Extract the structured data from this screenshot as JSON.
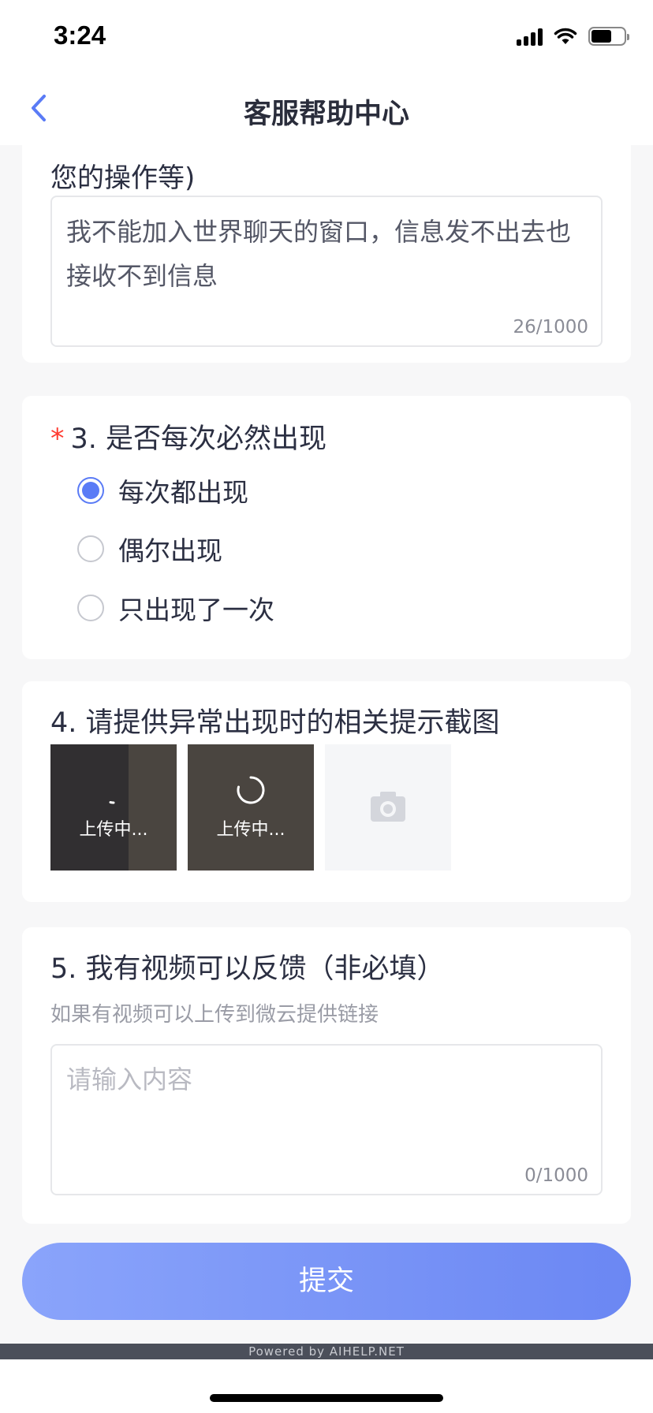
{
  "status_bar": {
    "time": "3:24"
  },
  "nav": {
    "title": "客服帮助中心",
    "back_icon": "chevron-left-icon"
  },
  "question2": {
    "title_continued": "您的操作等)",
    "value": "我不能加入世界聊天的窗口，信息发不出去也接收不到信息",
    "counter": "26/1000"
  },
  "question3": {
    "required_mark": "*",
    "title": "3. 是否每次必然出现",
    "options": [
      {
        "label": "每次都出现",
        "selected": true
      },
      {
        "label": "偶尔出现",
        "selected": false
      },
      {
        "label": "只出现了一次",
        "selected": false
      }
    ]
  },
  "question4": {
    "title": "4. 请提供异常出现时的相关提示截图",
    "uploads": [
      {
        "status": "上传中..."
      },
      {
        "status": "上传中..."
      }
    ],
    "add_icon": "camera-icon"
  },
  "question5": {
    "title": "5. 我有视频可以反馈（非必填）",
    "hint": "如果有视频可以上传到微云提供链接",
    "placeholder": "请输入内容",
    "counter": "0/1000"
  },
  "submit_label": "提交",
  "footer": {
    "powered": "Powered by AIHELP.NET"
  },
  "colors": {
    "accent": "#5a7bf6",
    "required": "#ff3b30",
    "button_start": "#8aa4fb",
    "button_end": "#6b87f3"
  }
}
